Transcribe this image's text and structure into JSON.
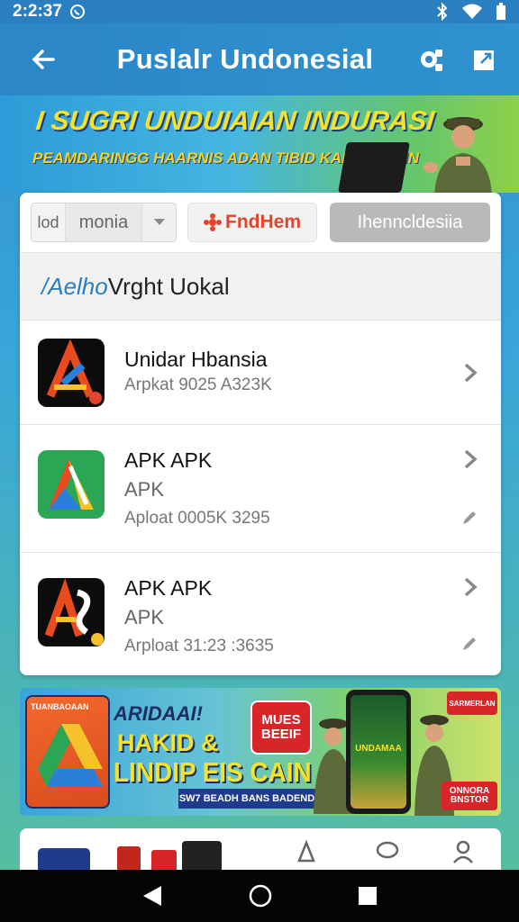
{
  "status_bar": {
    "time": "2:2:37",
    "icons": [
      "whatsapp-icon",
      "bluetooth-icon",
      "wifi-icon",
      "battery-icon"
    ]
  },
  "app_bar": {
    "title": "Puslalr Undonesial",
    "back_icon": "arrow-left-icon",
    "action_icons": [
      "settings-icon",
      "share-icon"
    ]
  },
  "top_banner": {
    "headline": "I  SUGRI UNDUIAIAN INDURASI",
    "subline": "PEAMDARINGG HAARNIS ADAN TIBID KADNGISLIIN"
  },
  "filters": {
    "segment_left": "lod",
    "segment_value": "monia",
    "find_button": "FndHem",
    "gray_button": "Ihenncldesiia"
  },
  "section": {
    "accent": "/Aelho",
    "title": " Vrght Uokal"
  },
  "apps": [
    {
      "name": "Unidar Hbansia",
      "subtitle": "",
      "meta": "Arpkat 9025 A323K"
    },
    {
      "name": "APK APK",
      "subtitle": "APK",
      "meta": "Aploat 0005K 3295"
    },
    {
      "name": "APK  APK",
      "subtitle": "APK",
      "meta": "Arploat 31:23 :3635"
    }
  ],
  "bottom_banner": {
    "box_header": "TUANBAOAAN",
    "line1": "ARIDAAI!",
    "line2": "HAKID &",
    "line3": "LINDIP EIS CAIN S",
    "badge": "MUES BEEIF",
    "strip": "SW7 BEADH BANS BADEND",
    "phone_text": "UNDAMAA",
    "right_badge": "SARMERLAN",
    "right_tag": "ONNORA BNSTOR"
  },
  "colors": {
    "primary": "#2c86c8",
    "accent_red": "#e2452e",
    "banner_yellow": "#f5e22c"
  }
}
